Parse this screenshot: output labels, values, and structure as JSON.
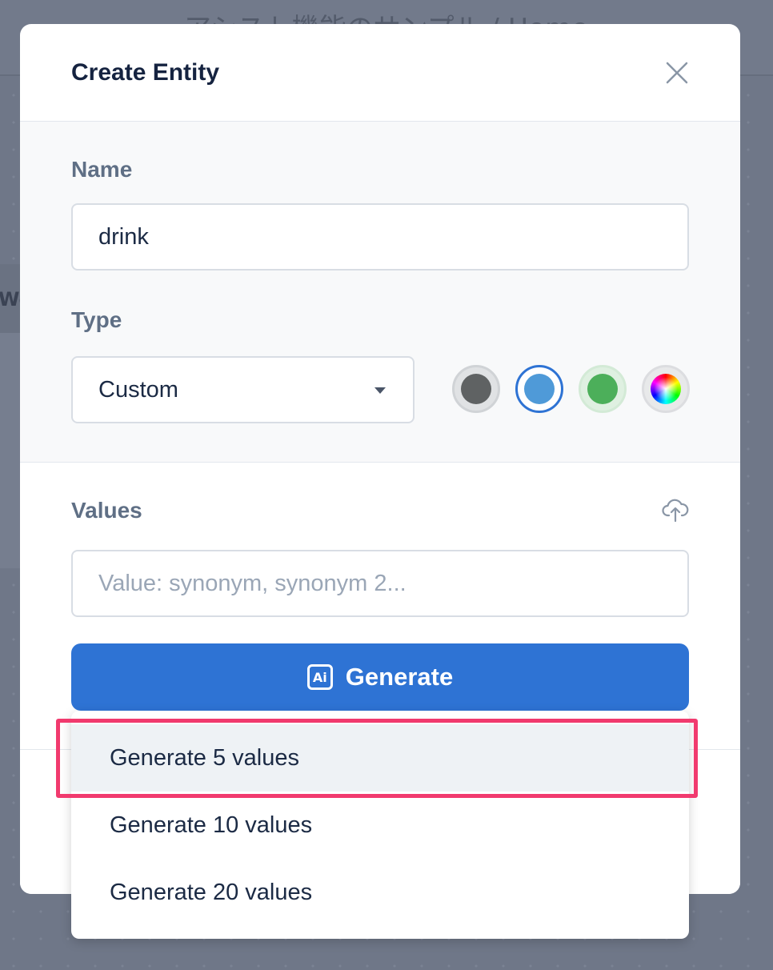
{
  "background": {
    "breadcrumb": "アシスト機能のサンプル / Home",
    "side_tab": "We"
  },
  "modal": {
    "title": "Create Entity",
    "close_icon": "close-icon",
    "name": {
      "label": "Name",
      "value": "drink"
    },
    "type": {
      "label": "Type",
      "selected": "Custom",
      "colors": [
        {
          "name": "gray",
          "hex": "#5f6263",
          "selected": false
        },
        {
          "name": "blue",
          "hex": "#4f9ad8",
          "selected": true
        },
        {
          "name": "green",
          "hex": "#4caf5a",
          "selected": false
        },
        {
          "name": "rainbow",
          "hex": "custom",
          "selected": false
        }
      ]
    },
    "values": {
      "label": "Values",
      "upload_icon": "cloud-upload-icon",
      "placeholder": "Value: synonym, synonym 2..."
    },
    "generate_button": {
      "label": "Generate",
      "icon": "ai-icon",
      "icon_text": "Ai"
    }
  },
  "dropdown": {
    "items": [
      {
        "label": "Generate 5 values",
        "active": true
      },
      {
        "label": "Generate 10 values",
        "active": false
      },
      {
        "label": "Generate 20 values",
        "active": false
      }
    ]
  },
  "colors": {
    "primary": "#2e73d4",
    "highlight": "#f13a6e",
    "overlay": "#6d7587"
  }
}
